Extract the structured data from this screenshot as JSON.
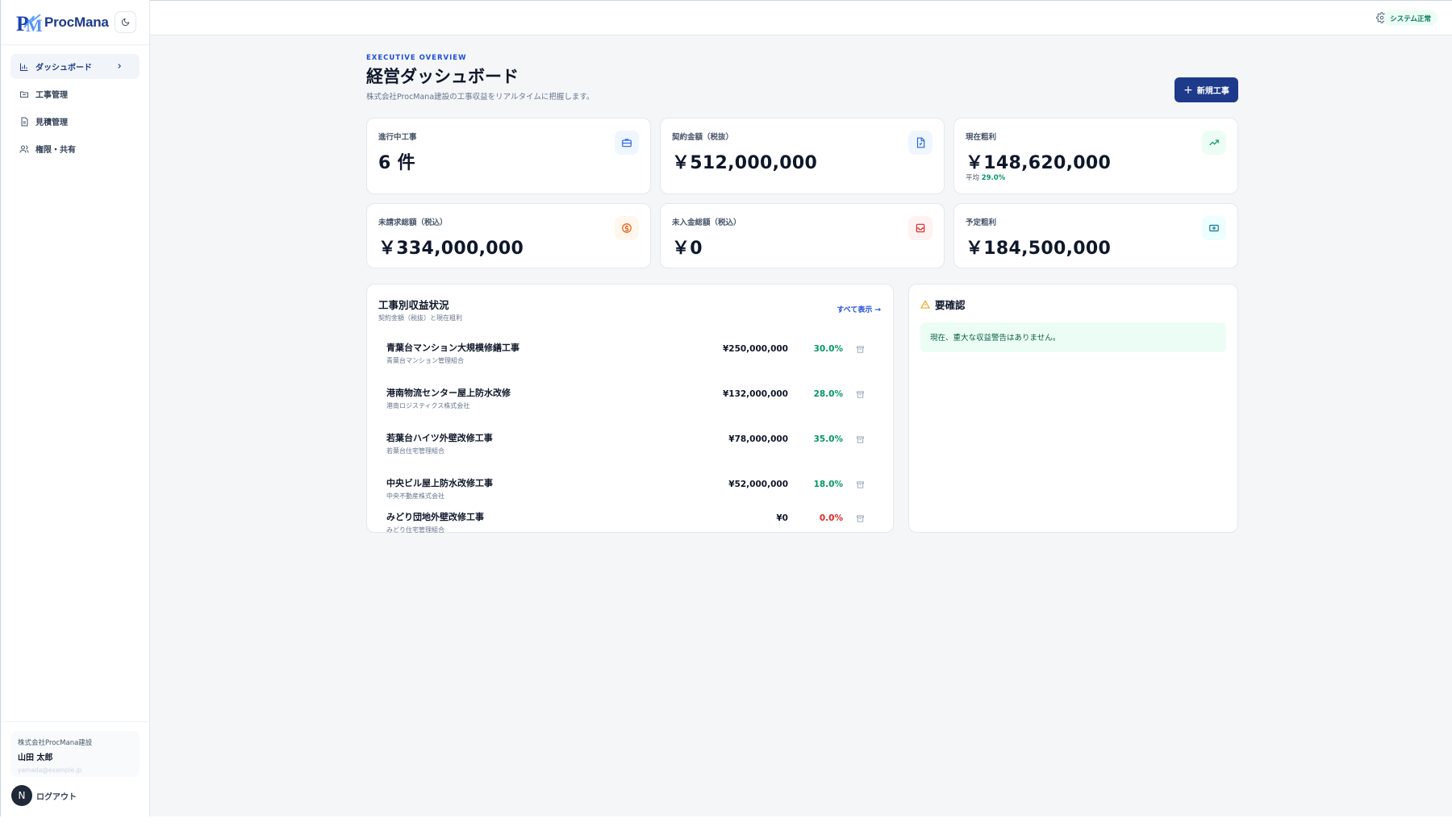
{
  "brand": {
    "name": "ProcMana"
  },
  "sidebar": {
    "items": [
      {
        "label": "ダッシュボード",
        "icon": "bar-chart-icon",
        "active": true
      },
      {
        "label": "工事管理",
        "icon": "folder-icon"
      },
      {
        "label": "見積管理",
        "icon": "document-icon"
      },
      {
        "label": "権限・共有",
        "icon": "users-icon"
      }
    ],
    "user": {
      "company": "株式会社ProcMana建設",
      "name": "山田 太郎",
      "email": "yamada@example.jp"
    },
    "avatar_letter": "N",
    "logout_label": "ログアウト"
  },
  "topbar": {
    "status": "システム正常"
  },
  "header": {
    "eyebrow": "EXECUTIVE OVERVIEW",
    "title": "経営ダッシュボード",
    "subtitle": "株式会社ProcMana建設の工事収益をリアルタイムに把握します。",
    "new_button": "新規工事"
  },
  "kpis": [
    {
      "label": "進行中工事",
      "value": "6 件",
      "icon": "briefcase-icon",
      "color": "#2563eb"
    },
    {
      "label": "契約金額（税抜）",
      "value": "￥512,000,000",
      "icon": "file-icon",
      "color": "#2563eb"
    },
    {
      "label": "現在粗利",
      "value": "￥148,620,000",
      "sub_prefix": "平均",
      "sub_value": "29.0%",
      "icon": "trending-up-icon",
      "color": "#059669"
    },
    {
      "label": "未請求総額（税込）",
      "value": "￥334,000,000",
      "icon": "coin-icon",
      "color": "#ea580c"
    },
    {
      "label": "未入金総額（税込）",
      "value": "￥0",
      "icon": "inbox-icon",
      "color": "#dc2626"
    },
    {
      "label": "予定粗利",
      "value": "￥184,500,000",
      "icon": "banknote-icon",
      "color": "#0e7490"
    }
  ],
  "projects_panel": {
    "title": "工事別収益状況",
    "subtitle": "契約金額（税抜）と現在粗利",
    "view_all": "すべて表示 →",
    "rows": [
      {
        "name": "青葉台マンション大規模修繕工事",
        "client": "青葉台マンション管理組合",
        "amount": "¥250,000,000",
        "rate": "30.0%"
      },
      {
        "name": "港南物流センター屋上防水改修",
        "client": "港南ロジスティクス株式会社",
        "amount": "¥132,000,000",
        "rate": "28.0%"
      },
      {
        "name": "若葉台ハイツ外壁改修工事",
        "client": "若葉台住宅管理組合",
        "amount": "¥78,000,000",
        "rate": "35.0%"
      },
      {
        "name": "中央ビル屋上防水改修工事",
        "client": "中央不動産株式会社",
        "amount": "¥52,000,000",
        "rate": "18.0%"
      },
      {
        "name": "みどり団地外壁改修工事",
        "client": "みどり住宅管理組合",
        "amount": "¥0",
        "rate": "0.0%"
      }
    ]
  },
  "alerts_panel": {
    "title": "要確認",
    "message": "現在、重大な収益警告はありません。"
  }
}
